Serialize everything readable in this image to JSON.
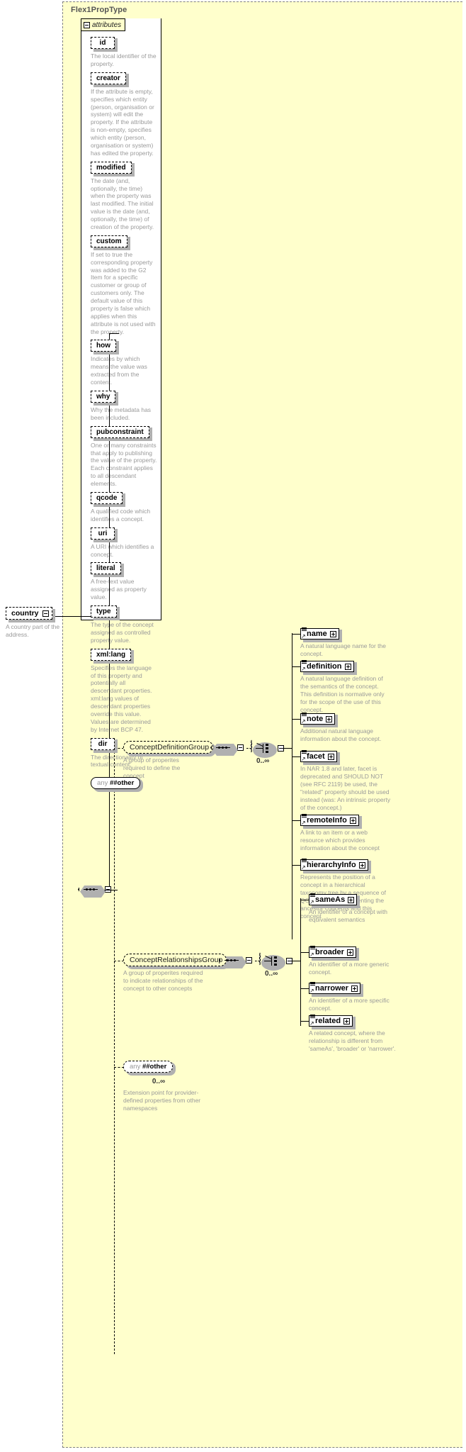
{
  "diagram": {
    "type_name": "Flex1PropType",
    "attributes_section_label": "attributes",
    "attributes": [
      {
        "name": "id",
        "description": "The local identifier of the property."
      },
      {
        "name": "creator",
        "description": "If the attribute is empty, specifies which entity (person, organisation or system) will edit the property. If the attribute is non-empty, specifies which entity (person, organisation or system) has edited the property."
      },
      {
        "name": "modified",
        "description": "The date (and, optionally, the time) when the property was last modified. The initial value is the date (and, optionally, the time) of creation of the property."
      },
      {
        "name": "custom",
        "description": "If set to true the corresponding property was added to the G2 Item for a specific customer or group of customers only. The default value of this property is false which applies when this attribute is not used with the property."
      },
      {
        "name": "how",
        "description": "Indicates by which means the value was extracted from the content."
      },
      {
        "name": "why",
        "description": "Why the metadata has been included."
      },
      {
        "name": "pubconstraint",
        "description": "One or many constraints that apply to publishing the value of the property. Each constraint applies to all descendant elements."
      },
      {
        "name": "qcode",
        "description": "A qualified code which identifies a concept."
      },
      {
        "name": "uri",
        "description": "A URI which identifies a concept."
      },
      {
        "name": "literal",
        "description": "A free-text value assigned as property value."
      },
      {
        "name": "type",
        "description": "The type of the concept assigned as controlled property value."
      },
      {
        "name": "xml:lang",
        "description": "Specifies the language of this property and potentially all descendant properties. xml:lang values of descendant properties override this value. Values are determined by Internet BCP 47."
      },
      {
        "name": "dir",
        "description": "The directionality of textual content."
      }
    ],
    "attributes_any": {
      "prefix": "any",
      "namespace": "##other"
    },
    "root_element": {
      "name": "country",
      "description": "A country part of the address."
    },
    "groups": [
      {
        "id": "concept-definition-group",
        "name": "ConceptDefinitionGroup",
        "description": "A group of properites required to define the concept",
        "occurs": "0..∞",
        "elements": [
          {
            "name": "name",
            "description": "A natural language name for the concept."
          },
          {
            "name": "definition",
            "description": "A natural language definition of the semantics of the concept. This definition is normative only for the scope of the use of this concept."
          },
          {
            "name": "note",
            "description": "Additional natural language information about the concept."
          },
          {
            "name": "facet",
            "description": "In NAR 1.8 and later, facet is deprecated and SHOULD NOT (see RFC 2119) be used, the \"related\" property should be used instead (was: An intrinsic property of the concept.)"
          },
          {
            "name": "remoteInfo",
            "description": "A link to an item or a web resource which provides information about the concept"
          },
          {
            "name": "hierarchyInfo",
            "description": "Represents the position of a concept in a hierarchical taxonomy tree by a sequence of QCode tokens representing the ancestor concepts and this concept"
          }
        ]
      },
      {
        "id": "concept-relationships-group",
        "name": "ConceptRelationshipsGroup",
        "description": "A group of properites required to indicate relationships of the concept to other concepts",
        "occurs": "0..∞",
        "elements": [
          {
            "name": "sameAs",
            "description": "An identifier of a concept with equivalent semantics"
          },
          {
            "name": "broader",
            "description": "An identifier of a more generic concept."
          },
          {
            "name": "narrower",
            "description": "An identifier of a more specific concept."
          },
          {
            "name": "related",
            "description": "A related concept, where the relationship is different from 'sameAs', 'broader' or 'narrower'."
          }
        ]
      }
    ],
    "extension_any": {
      "prefix": "any",
      "namespace": "##other",
      "occurs": "0..∞",
      "description": "Extension point for provider-defined properties from other namespaces"
    },
    "colors": {
      "background": "#ffffcc",
      "panel": "#ffffff",
      "text": "#000000",
      "description_text": "#9a9a9a",
      "shadow": "#b0b0b0",
      "line": "#000000"
    }
  }
}
